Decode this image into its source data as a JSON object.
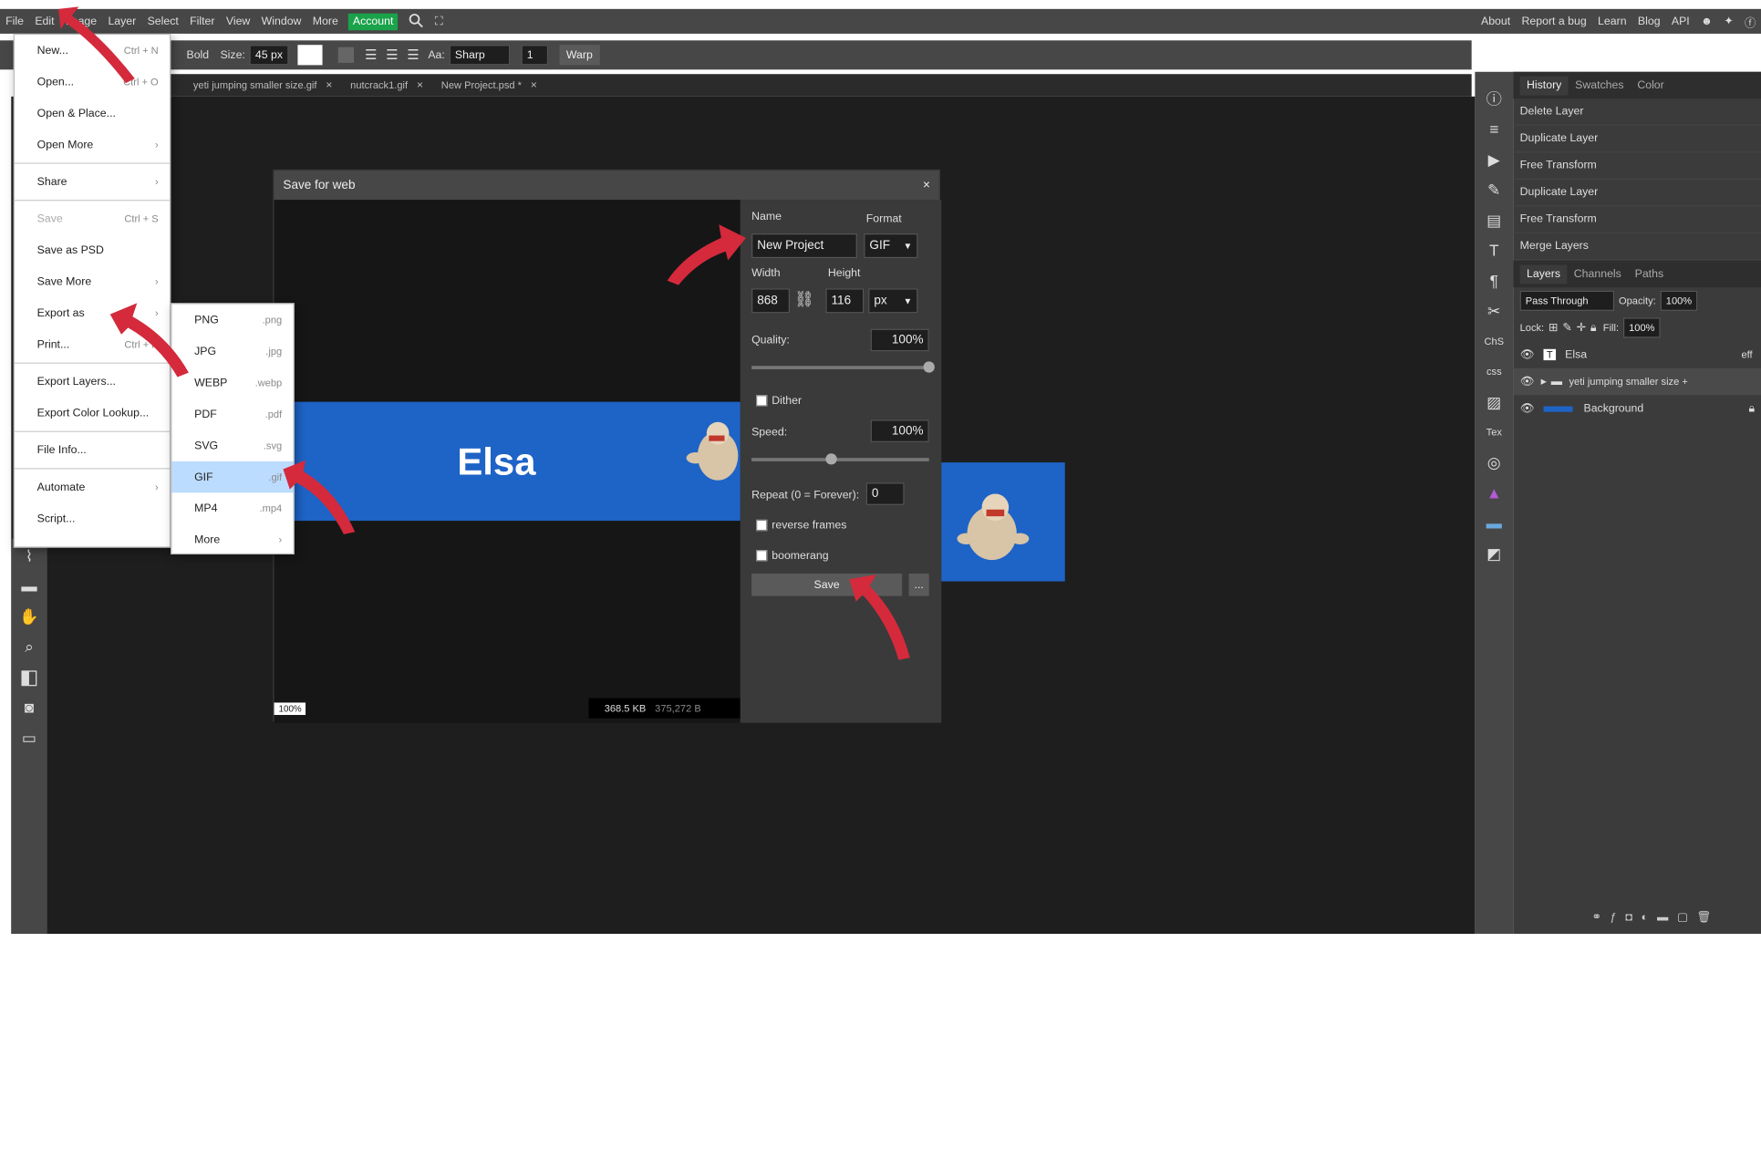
{
  "menubar": {
    "items": [
      "File",
      "Edit",
      "Image",
      "Layer",
      "Select",
      "Filter",
      "View",
      "Window",
      "More"
    ],
    "account": "Account",
    "right_links": [
      "About",
      "Report a bug",
      "Learn",
      "Blog",
      "API"
    ]
  },
  "options": {
    "weight": "Bold",
    "size_label": "Size:",
    "size_value": "45 px",
    "aa_label": "Aa:",
    "aa_value": "Sharp",
    "spacing_value": "1",
    "warp": "Warp"
  },
  "tabs": [
    "yeti jumping smaller size.gif",
    "nutcrack1.gif",
    "New Project.psd *"
  ],
  "file_menu": [
    {
      "label": "New...",
      "shortcut": "Ctrl + N"
    },
    {
      "label": "Open...",
      "shortcut": "Ctrl + O"
    },
    {
      "label": "Open & Place...",
      "shortcut": ""
    },
    {
      "label": "Open More",
      "shortcut": "›"
    },
    {
      "label": "Share",
      "shortcut": "›"
    },
    {
      "label": "Save",
      "shortcut": "Ctrl + S"
    },
    {
      "label": "Save as PSD",
      "shortcut": ""
    },
    {
      "label": "Save More",
      "shortcut": "›"
    },
    {
      "label": "Export as",
      "shortcut": "›"
    },
    {
      "label": "Print...",
      "shortcut": "Ctrl + P"
    },
    {
      "label": "Export Layers...",
      "shortcut": ""
    },
    {
      "label": "Export Color Lookup...",
      "shortcut": ""
    },
    {
      "label": "File Info...",
      "shortcut": ""
    },
    {
      "label": "Automate",
      "shortcut": "›"
    },
    {
      "label": "Script...",
      "shortcut": ""
    }
  ],
  "export_menu": [
    {
      "label": "PNG",
      "ext": ".png"
    },
    {
      "label": "JPG",
      "ext": ".jpg"
    },
    {
      "label": "WEBP",
      "ext": ".webp"
    },
    {
      "label": "PDF",
      "ext": ".pdf"
    },
    {
      "label": "SVG",
      "ext": ".svg"
    },
    {
      "label": "GIF",
      "ext": ".gif"
    },
    {
      "label": "MP4",
      "ext": ".mp4"
    },
    {
      "label": "More",
      "ext": "›"
    }
  ],
  "dialog": {
    "title": "Save for web",
    "close": "×",
    "name_label": "Name",
    "name_value": "New Project",
    "format_label": "Format",
    "format_value": "GIF",
    "width_label": "Width",
    "width_value": "868",
    "height_label": "Height",
    "height_value": "116",
    "unit": "px",
    "quality_label": "Quality:",
    "quality_value": "100%",
    "quality_level": 1.0,
    "dither_label": "Dither",
    "speed_label": "Speed:",
    "speed_value": "100%",
    "speed_level": 0.45,
    "repeat_label": "Repeat (0 = Forever):",
    "repeat_value": "0",
    "reverse_label": "reverse frames",
    "boomerang_label": "boomerang",
    "save_label": "Save",
    "more_label": "...",
    "zoom": "100%",
    "size_new": "368.5 KB",
    "size_old": "375,272 B",
    "banner_text": "Elsa"
  },
  "right_panel": {
    "top_tabs": [
      "History",
      "Swatches",
      "Color"
    ],
    "history": [
      "Delete Layer",
      "Duplicate Layer",
      "Free Transform",
      "Duplicate Layer",
      "Free Transform",
      "Merge Layers"
    ],
    "layer_tabs": [
      "Layers",
      "Channels",
      "Paths"
    ],
    "blend_mode": "Pass Through",
    "opacity_label": "Opacity:",
    "opacity_value": "100%",
    "lock_label": "Lock:",
    "fill_label": "Fill:",
    "fill_value": "100%",
    "layers": [
      "Elsa",
      "yeti jumping smaller size +",
      "Background"
    ],
    "effects_label": "eff"
  },
  "colors": {
    "accent_green": "#1aa34a",
    "banner_blue": "#1e63c6",
    "arrow_red": "#d42a3c"
  }
}
